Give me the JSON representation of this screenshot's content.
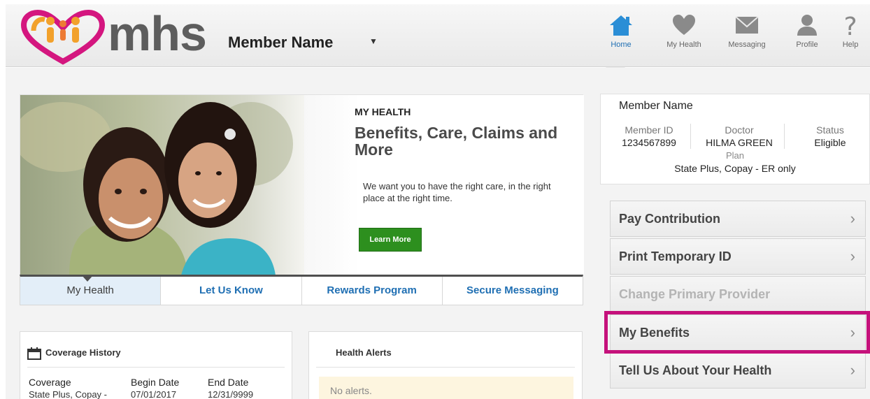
{
  "header": {
    "logo_text": "mhs",
    "member_name": "Member Name",
    "caret": "▼",
    "nav": [
      {
        "label": "Home",
        "icon": "home-icon",
        "active": true
      },
      {
        "label": "My Health",
        "icon": "heart-icon",
        "active": false
      },
      {
        "label": "Messaging",
        "icon": "envelope-icon",
        "active": false
      },
      {
        "label": "Profile",
        "icon": "person-icon",
        "active": false
      },
      {
        "label": "Help",
        "icon": "question-icon",
        "active": false
      }
    ]
  },
  "hero": {
    "kicker": "MY HEALTH",
    "title": "Benefits, Care, Claims and More",
    "description": "We want you to have the right care, in the right place at the right time.",
    "button": "Learn More"
  },
  "tabs": [
    "My Health",
    "Let Us Know",
    "Rewards Program",
    "Secure Messaging"
  ],
  "coverage": {
    "title": "Coverage History",
    "headers": [
      "Coverage",
      "Begin Date",
      "End Date"
    ],
    "row": [
      "State Plus, Copay -",
      "07/01/2017",
      "12/31/9999"
    ]
  },
  "alerts": {
    "title": "Health Alerts",
    "message": "No alerts."
  },
  "summary": {
    "name": "Member Name",
    "member_id_label": "Member ID",
    "member_id": "1234567899",
    "doctor_label": "Doctor",
    "doctor": "HILMA GREEN",
    "status_label": "Status",
    "status": "Eligible",
    "plan_label": "Plan",
    "plan": "State Plus, Copay - ER only"
  },
  "actions": [
    {
      "label": "Pay Contribution",
      "chevron": "›"
    },
    {
      "label": "Print Temporary ID",
      "chevron": "›"
    },
    {
      "label": "Change Primary Provider",
      "chevron": ""
    },
    {
      "label": "My Benefits",
      "chevron": "›"
    },
    {
      "label": "Tell Us About Your Health",
      "chevron": "›"
    }
  ],
  "colors": {
    "accent_blue": "#1f6fb3",
    "learn_green": "#2d8f1e",
    "highlight_magenta": "#c5117b",
    "logo_orange": "#f2a12b",
    "logo_magenta": "#d4167f"
  }
}
